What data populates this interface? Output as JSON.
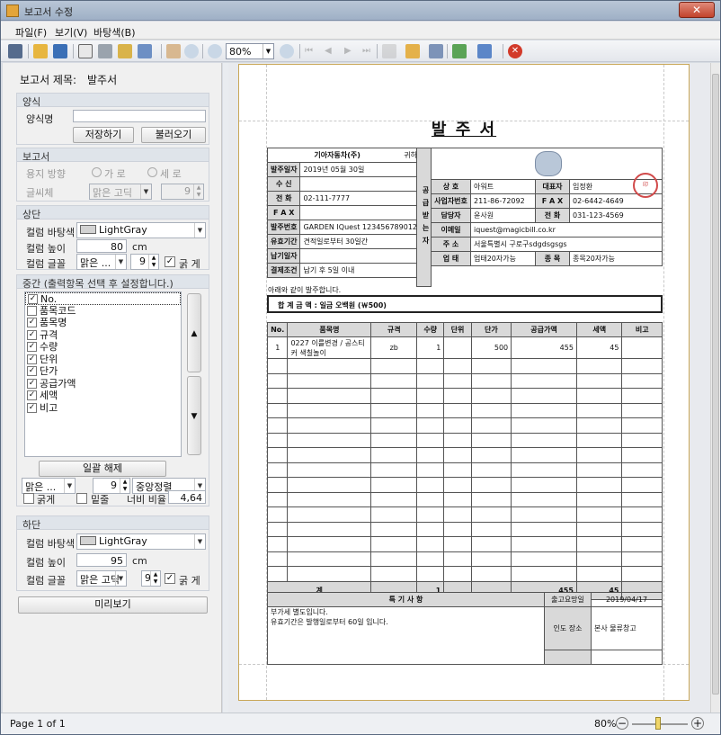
{
  "window": {
    "title": "보고서 수정"
  },
  "menu": [
    "파일(F)",
    "보기(V)",
    "바탕색(B)"
  ],
  "toolbar": {
    "zoom": "80%"
  },
  "left": {
    "report_title_label": "보고서 제목:",
    "report_title_value": "발주서",
    "form_group": {
      "title": "양식",
      "name_label": "양식명",
      "name_value": "",
      "save": "저장하기",
      "load": "불러오기"
    },
    "report_group": {
      "title": "보고서",
      "orientation_label": "용지 방향",
      "portrait": "가 로",
      "landscape": "세 로",
      "font_label": "글씨체",
      "font_value": "맑은 고딕",
      "font_size": "9"
    },
    "top_group": {
      "title": "상단",
      "bg_label": "컬럼 바탕색",
      "bg_value": "LightGray",
      "height_label": "컬럼 높이",
      "height_value": "80",
      "height_unit": "cm",
      "font_label": "컬럼 글꼴",
      "font_value": "맑은 ...",
      "font_size": "9",
      "bold": "굵 게"
    },
    "middle_group": {
      "title": "중간 (출력항목 선택 후 설정합니다.)",
      "items": [
        {
          "label": "No.",
          "checked": true
        },
        {
          "label": "품목코드",
          "checked": false
        },
        {
          "label": "품목명",
          "checked": true
        },
        {
          "label": "규격",
          "checked": true
        },
        {
          "label": "수량",
          "checked": true
        },
        {
          "label": "단위",
          "checked": true
        },
        {
          "label": "단가",
          "checked": true
        },
        {
          "label": "공급가액",
          "checked": true
        },
        {
          "label": "세액",
          "checked": true
        },
        {
          "label": "비고",
          "checked": true
        }
      ],
      "unselect_all": "일괄 해제",
      "font_value": "맑은 ...",
      "font_size": "9",
      "align_value": "중앙정렬",
      "bold": "굵게",
      "underline": "밑줄",
      "width_ratio_label": "너비 비율",
      "width_ratio_value": "4,64"
    },
    "bottom_group": {
      "title": "하단",
      "bg_label": "컬럼 바탕색",
      "bg_value": "LightGray",
      "height_label": "컬럼 높이",
      "height_value": "95",
      "height_unit": "cm",
      "font_label": "컬럼 글꼴",
      "font_value": "맑은 고딕",
      "font_size": "9",
      "bold": "굵 게"
    },
    "preview_button": "미리보기"
  },
  "doc": {
    "title": "발 주 서",
    "to_company": "기아자동차(주)",
    "to_suffix": "귀하",
    "left_fields": [
      {
        "label": "발주일자",
        "value": "2019년 05월 30일"
      },
      {
        "label": "수      신",
        "value": ""
      },
      {
        "label": "전      화",
        "value": "02-111-7777"
      },
      {
        "label": "F A X",
        "value": ""
      },
      {
        "label": "발주번호",
        "value": "GARDEN IQuest 123456789012"
      },
      {
        "label": "유효기간",
        "value": "견적일로부터 30일간"
      },
      {
        "label": "납기일자",
        "value": ""
      },
      {
        "label": "결제조건",
        "value": "납기 후 5일 이내"
      }
    ],
    "supplier_vertical": "공급받는자",
    "supplier": {
      "trade_name_label": "상 호",
      "trade_name": "아워트",
      "ceo_label": "대표자",
      "ceo": "임정환",
      "bizno_label": "사업자번호",
      "bizno": "211-86-72092",
      "fax_label": "F A X",
      "fax": "02-6442-4649",
      "manager_label": "담당자",
      "manager": "윤사원",
      "phone_label": "전 화",
      "phone": "031-123-4569",
      "email_label": "이메일",
      "email": "iquest@magicbill.co.kr",
      "address_label": "주 소",
      "address": "서울특별시 구로구sdgdsgsgs",
      "biztype_label": "업 태",
      "biztype": "업태20자가능",
      "item_label": "종 목",
      "item": "종목20자가능"
    },
    "note_line": "아래와 같이 발주합니다.",
    "total_line": "합 계 금 액   :   일금 오백원 (￦500)",
    "columns": [
      "No.",
      "품목명",
      "규격",
      "수량",
      "단위",
      "단가",
      "공급가액",
      "세액",
      "비고"
    ],
    "rows": [
      [
        "1",
        "0227 이를변경 / 공스티커 색칠놀이",
        "zb",
        "1",
        "",
        "500",
        "455",
        "45",
        ""
      ]
    ],
    "total_row": {
      "label": "계",
      "qty": "1",
      "supply": "455",
      "tax": "45"
    },
    "footer": {
      "notes_head": "특 기 사 항",
      "notes": [
        "부가세 별도입니다.",
        "유효기간은 발행일로부터 60일 입니다."
      ],
      "due_label": "출고요망일",
      "due": "2019/04/17",
      "delivery_label": "인도 장소",
      "delivery": "본사 물류창고"
    }
  },
  "status": {
    "page": "Page 1 of 1",
    "zoom": "80%"
  }
}
